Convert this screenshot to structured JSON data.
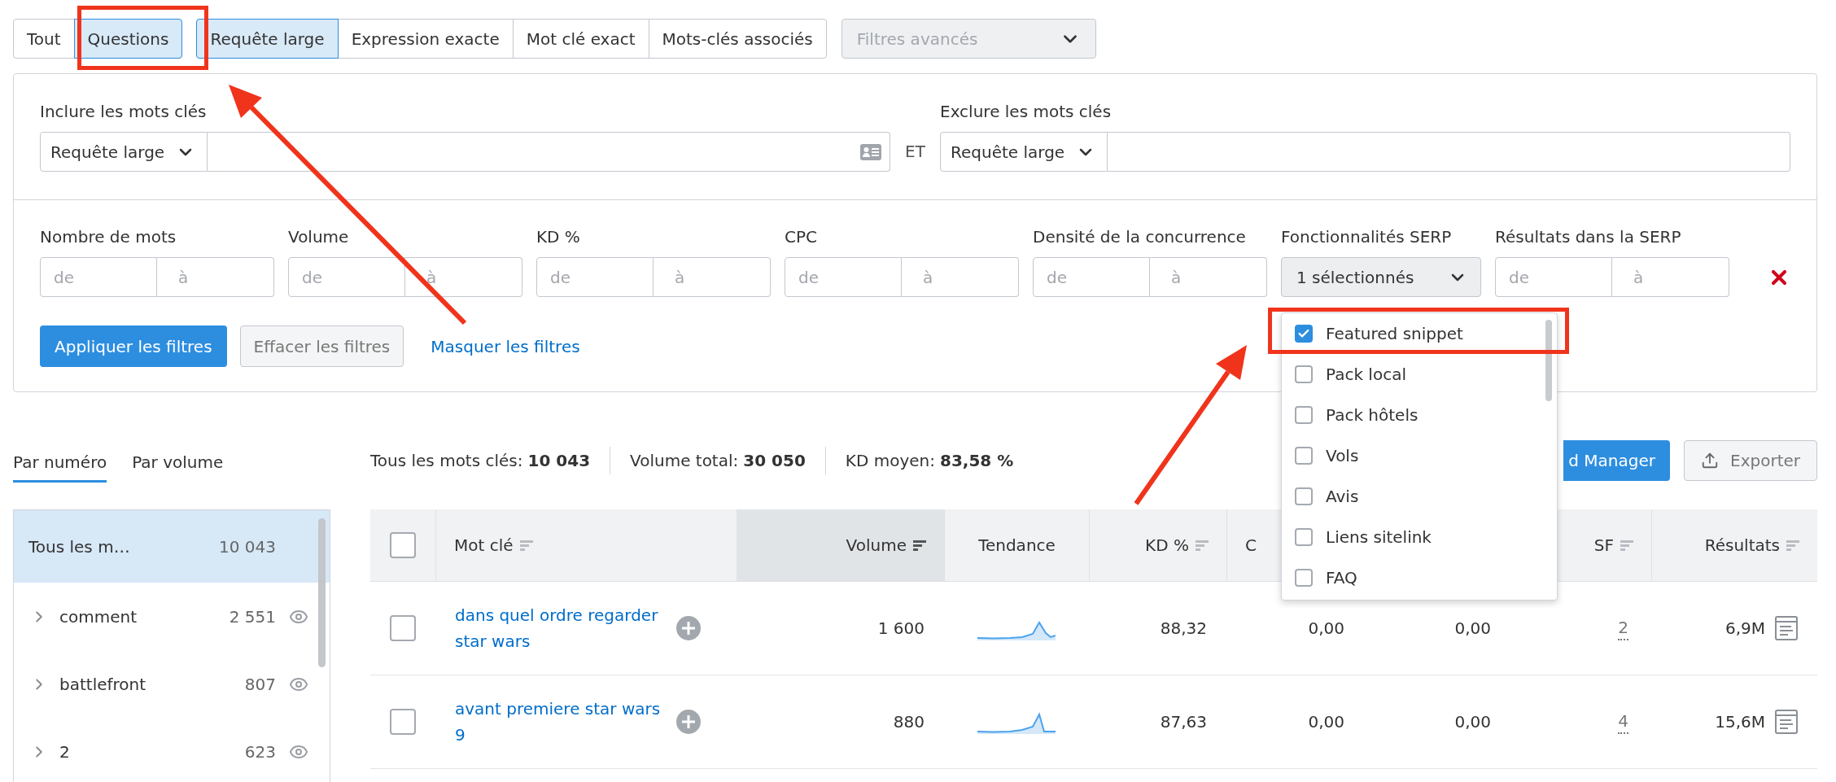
{
  "match_tabs": [
    {
      "label": "Tout",
      "selected": false
    },
    {
      "label": "Questions",
      "selected": true
    }
  ],
  "match_types": [
    {
      "label": "Requête large",
      "selected": true
    },
    {
      "label": "Expression exacte",
      "selected": false
    },
    {
      "label": "Mot clé exact",
      "selected": false
    },
    {
      "label": "Mots-clés associés",
      "selected": false
    }
  ],
  "advanced_filters": {
    "placeholder": "Filtres avancés"
  },
  "include": {
    "label": "Inclure les mots clés",
    "mode": "Requête large"
  },
  "connector": "ET",
  "exclude": {
    "label": "Exclure les mots clés",
    "mode": "Requête large"
  },
  "filters": [
    {
      "kind": "range",
      "label": "Nombre de mots",
      "from": {
        "placeholder": "de"
      },
      "to": {
        "placeholder": "à"
      }
    },
    {
      "kind": "range",
      "label": "Volume",
      "from": {
        "placeholder": "de"
      },
      "to": {
        "placeholder": "à"
      }
    },
    {
      "kind": "range",
      "label": "KD %",
      "from": {
        "placeholder": "de"
      },
      "to": {
        "placeholder": "à"
      }
    },
    {
      "kind": "range",
      "label": "CPC",
      "from": {
        "placeholder": "de"
      },
      "to": {
        "placeholder": "à"
      }
    },
    {
      "kind": "range",
      "label": "Densité de la concurrence",
      "from": {
        "placeholder": "de"
      },
      "to": {
        "placeholder": "à"
      }
    },
    {
      "kind": "select",
      "label": "Fonctionnalités SERP",
      "value": "1 sélectionnés",
      "expanded": true
    },
    {
      "kind": "range",
      "label": "Résultats dans la SERP",
      "from": {
        "placeholder": "de"
      },
      "to": {
        "placeholder": "à"
      }
    }
  ],
  "serp_options": [
    {
      "label": "Featured snippet",
      "checked": true
    },
    {
      "label": "Pack local",
      "checked": false
    },
    {
      "label": "Pack hôtels",
      "checked": false
    },
    {
      "label": "Vols",
      "checked": false
    },
    {
      "label": "Avis",
      "checked": false
    },
    {
      "label": "Liens sitelink",
      "checked": false
    },
    {
      "label": "FAQ",
      "checked": false
    }
  ],
  "filter_actions": {
    "apply": "Appliquer les filtres",
    "clear": "Effacer les filtres",
    "hide": "Masquer les filtres"
  },
  "group_tabs": [
    {
      "label": "Par numéro",
      "selected": true
    },
    {
      "label": "Par volume",
      "selected": false
    }
  ],
  "groups": [
    {
      "kind": "all",
      "label": "Tous les m…",
      "count": "10 043",
      "selected": true
    },
    {
      "kind": "group",
      "label": "comment",
      "count": "2 551",
      "selected": false
    },
    {
      "kind": "group",
      "label": "battlefront",
      "count": "807",
      "selected": false
    },
    {
      "kind": "group",
      "label": "2",
      "count": "623",
      "selected": false
    }
  ],
  "summary": [
    {
      "label": "Tous les mots clés:",
      "value": "10 043"
    },
    {
      "label": "Volume total:",
      "value": "30 050"
    },
    {
      "label": "KD moyen:",
      "value": "83,58 %"
    }
  ],
  "actions": {
    "manager": "d Manager",
    "export": "Exporter"
  },
  "table": {
    "header_checked": false,
    "columns": [
      {
        "label": "Mot clé",
        "sortable": true,
        "sorted": false
      },
      {
        "label": "Volume",
        "sortable": true,
        "sorted": true
      },
      {
        "label": "Tendance",
        "sortable": false,
        "sorted": false
      },
      {
        "label": "KD %",
        "sortable": true,
        "sorted": false
      },
      {
        "label": "C",
        "sortable": false,
        "sorted": false
      },
      {
        "label": "SF",
        "sortable": true,
        "sorted": false
      },
      {
        "label": "Résultats",
        "sortable": true,
        "sorted": false
      }
    ],
    "rows": [
      {
        "checked": false,
        "keyword": "dans quel ordre regarder star wars",
        "volume": "1 600",
        "kd": "88,32",
        "cpc": "0,00",
        "column_6": "0,00",
        "sf": "2",
        "results": "6,9M"
      },
      {
        "checked": false,
        "keyword": "avant premiere star wars 9",
        "volume": "880",
        "kd": "87,63",
        "cpc": "0,00",
        "column_6": "0,00",
        "sf": "4",
        "results": "15,6M"
      }
    ]
  }
}
